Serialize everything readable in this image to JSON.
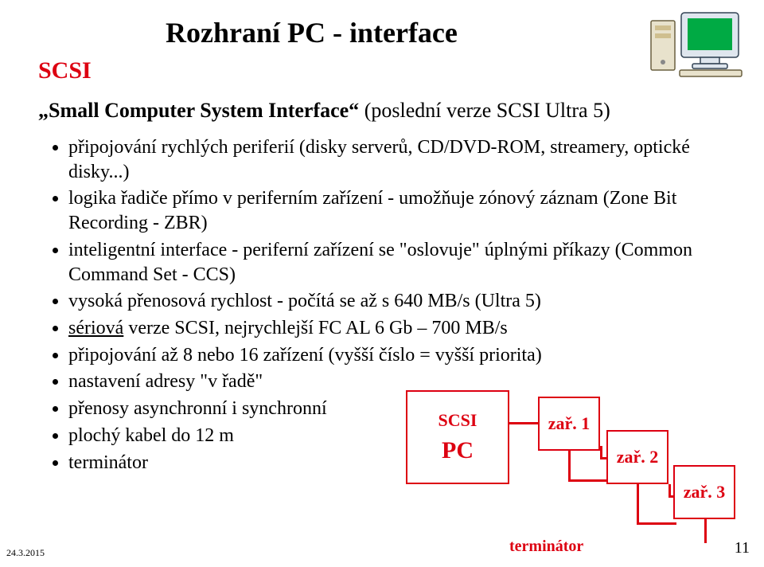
{
  "title": "Rozhraní PC - interface",
  "subhead": "SCSI",
  "quoteline_prefix": "„Small Computer System Interface“ ",
  "quoteline_suffix": "(poslední verze SCSI Ultra 5)",
  "bullets": {
    "b0": "připojování rychlých periferií (disky serverů, CD/DVD-ROM, streamery, optické disky...)",
    "b1": "logika řadiče přímo v periferním zařízení - umožňuje zónový záznam (Zone Bit Recording - ZBR)",
    "b2": "inteligentní interface - periferní zařízení se \"oslovuje\" úplnými příkazy (Common Command Set - CCS)",
    "b3": "vysoká přenosová rychlost - počítá se až s 640 MB/s (Ultra 5)",
    "b4_serial": "sériová",
    "b4_rest": " verze SCSI, nejrychlejší FC AL 6 Gb – 700 MB/s",
    "b5": "připojování až 8 nebo 16 zařízení (vyšší číslo = vyšší priorita)",
    "b6": "nastavení adresy \"v řadě\"",
    "b7": "přenosy asynchronní i synchronní",
    "b8": "plochý kabel do 12 m",
    "b9": "terminátor"
  },
  "diagram": {
    "scsi": "SCSI",
    "pc": "PC",
    "dev1": "zař. 1",
    "dev2": "zař. 2",
    "dev3": "zař. 3",
    "terminator": "terminátor"
  },
  "footer": {
    "date": "24.3.2015",
    "page": "11"
  },
  "icons": {
    "computer": "computer-illustration-icon"
  }
}
